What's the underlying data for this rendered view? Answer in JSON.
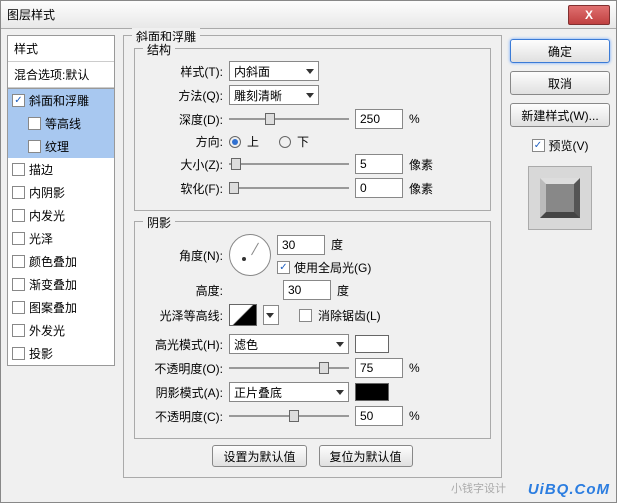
{
  "title": "图层样式",
  "close": "X",
  "left": {
    "styles_header": "样式",
    "blend_default": "混合选项:默认",
    "items": [
      {
        "label": "斜面和浮雕",
        "checked": true,
        "selected": true
      },
      {
        "label": "等高线",
        "checked": false,
        "selected": true,
        "sub": true
      },
      {
        "label": "纹理",
        "checked": false,
        "selected": true,
        "sub": true
      },
      {
        "label": "描边",
        "checked": false
      },
      {
        "label": "内阴影",
        "checked": false
      },
      {
        "label": "内发光",
        "checked": false
      },
      {
        "label": "光泽",
        "checked": false
      },
      {
        "label": "颜色叠加",
        "checked": false
      },
      {
        "label": "渐变叠加",
        "checked": false
      },
      {
        "label": "图案叠加",
        "checked": false
      },
      {
        "label": "外发光",
        "checked": false
      },
      {
        "label": "投影",
        "checked": false
      }
    ]
  },
  "main": {
    "section_title": "斜面和浮雕",
    "structure": {
      "title": "结构",
      "style_label": "样式(T):",
      "style_value": "内斜面",
      "technique_label": "方法(Q):",
      "technique_value": "雕刻清晰",
      "depth_label": "深度(D):",
      "depth_value": "250",
      "depth_unit": "%",
      "direction_label": "方向:",
      "up": "上",
      "down": "下",
      "size_label": "大小(Z):",
      "size_value": "5",
      "size_unit": "像素",
      "soften_label": "软化(F):",
      "soften_value": "0",
      "soften_unit": "像素"
    },
    "shading": {
      "title": "阴影",
      "angle_label": "角度(N):",
      "angle_value": "30",
      "angle_unit": "度",
      "global_label": "使用全局光(G)",
      "altitude_label": "高度:",
      "altitude_value": "30",
      "altitude_unit": "度",
      "gloss_label": "光泽等高线:",
      "antialias_label": "消除锯齿(L)",
      "highlight_mode_label": "高光模式(H):",
      "highlight_mode_value": "滤色",
      "highlight_opacity_label": "不透明度(O):",
      "highlight_opacity_value": "75",
      "pct": "%",
      "shadow_mode_label": "阴影模式(A):",
      "shadow_mode_value": "正片叠底",
      "shadow_opacity_label": "不透明度(C):",
      "shadow_opacity_value": "50"
    },
    "set_default": "设置为默认值",
    "reset_default": "复位为默认值"
  },
  "right": {
    "ok": "确定",
    "cancel": "取消",
    "new_style": "新建样式(W)...",
    "preview": "预览(V)"
  },
  "watermark": "UiBQ.CoM",
  "wm2": "小钱字设计"
}
